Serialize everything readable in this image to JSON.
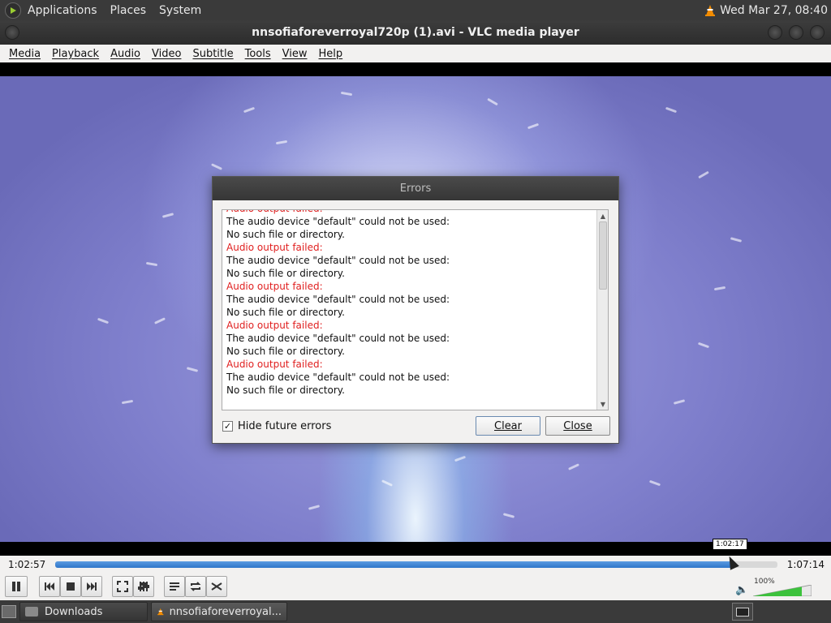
{
  "top_panel": {
    "menus": [
      "Applications",
      "Places",
      "System"
    ],
    "clock": "Wed Mar 27, 08:40"
  },
  "window": {
    "title": "nnsofiaforeverroyal720p (1).avi - VLC media player"
  },
  "menubar": [
    "Media",
    "Playback",
    "Audio",
    "Video",
    "Subtitle",
    "Tools",
    "View",
    "Help"
  ],
  "dialog": {
    "title": "Errors",
    "log": [
      {
        "text": "Audio output failed:",
        "error": true
      },
      {
        "text": "The audio device \"default\" could not be used:",
        "error": false
      },
      {
        "text": "No such file or directory.",
        "error": false
      },
      {
        "text": "Audio output failed:",
        "error": true
      },
      {
        "text": "The audio device \"default\" could not be used:",
        "error": false
      },
      {
        "text": "No such file or directory.",
        "error": false
      },
      {
        "text": "Audio output failed:",
        "error": true
      },
      {
        "text": "The audio device \"default\" could not be used:",
        "error": false
      },
      {
        "text": "No such file or directory.",
        "error": false
      },
      {
        "text": "Audio output failed:",
        "error": true
      },
      {
        "text": "The audio device \"default\" could not be used:",
        "error": false
      },
      {
        "text": "No such file or directory.",
        "error": false
      },
      {
        "text": "Audio output failed:",
        "error": true
      },
      {
        "text": "The audio device \"default\" could not be used:",
        "error": false
      },
      {
        "text": "No such file or directory.",
        "error": false
      }
    ],
    "hide_future_label": "Hide future errors",
    "hide_future_checked": true,
    "clear_label": "Clear",
    "close_label": "Close"
  },
  "timeline": {
    "current": "1:02:57",
    "total": "1:07:14",
    "hover_tooltip": "1:02:17",
    "progress_fraction": 0.936
  },
  "volume": {
    "percent_label": "100%",
    "level_fraction": 1.0
  },
  "taskbar": {
    "tasks": [
      "Downloads",
      "nnsofiaforeverroyal..."
    ]
  },
  "colors": {
    "error_text": "#e02020",
    "progress": "#2f76c9",
    "volume_green": "#3cc23c",
    "vlc_orange": "#f28c00"
  }
}
